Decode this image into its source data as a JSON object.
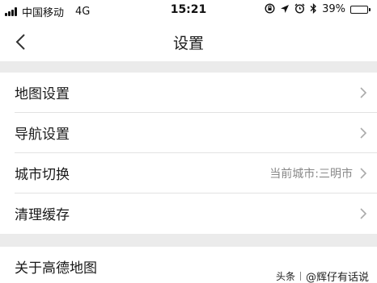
{
  "status_bar": {
    "carrier": "中国移动",
    "network": "4G",
    "time": "15:21",
    "battery_percent": "39%",
    "battery_level": 0.39,
    "icons": [
      "orientation-lock-icon",
      "location-arrow-icon",
      "alarm-icon",
      "bluetooth-icon",
      "battery-icon"
    ]
  },
  "nav": {
    "title": "设置",
    "back_icon": "chevron-left-icon"
  },
  "items": [
    {
      "label": "地图设置",
      "value": ""
    },
    {
      "label": "导航设置",
      "value": ""
    },
    {
      "label": "城市切换",
      "value": "当前城市:三明市"
    },
    {
      "label": "清理缓存",
      "value": ""
    },
    {
      "label": "关于高德地图",
      "value": ""
    }
  ],
  "watermark": {
    "prefix": "头条",
    "handle": "@辉仔有话说"
  },
  "colors": {
    "background": "#ebebeb",
    "surface": "#ffffff",
    "text": "#1a1a1a",
    "secondary_text": "#888888",
    "divider": "#e2e2e2"
  }
}
